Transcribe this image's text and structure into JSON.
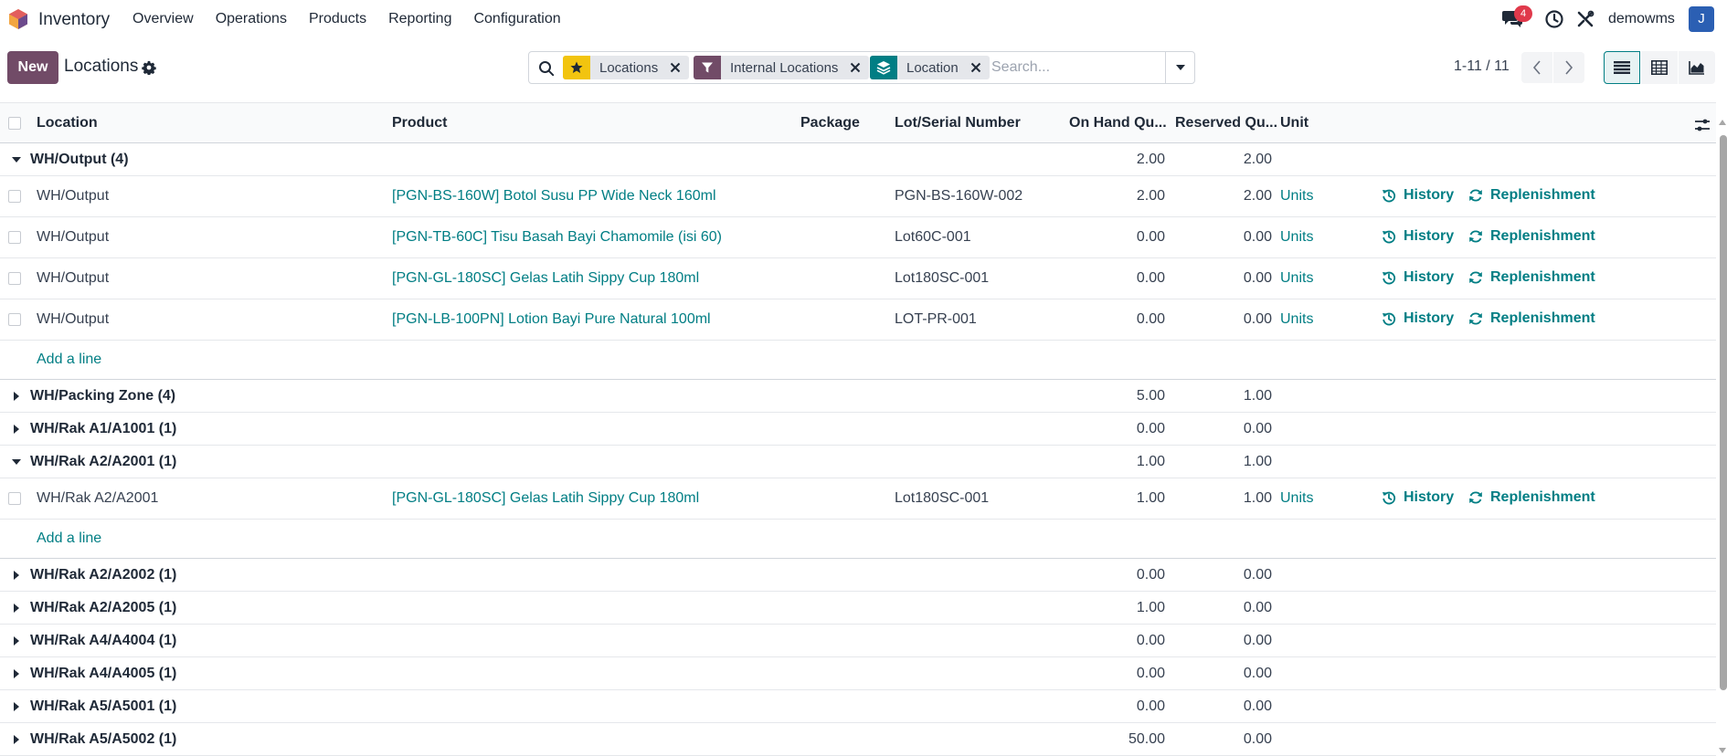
{
  "navbar": {
    "app_name": "Inventory",
    "menu": [
      "Overview",
      "Operations",
      "Products",
      "Reporting",
      "Configuration"
    ],
    "chat_badge": "4",
    "user_name": "demowms",
    "avatar_letter": "J"
  },
  "control_panel": {
    "new_label": "New",
    "title": "Locations",
    "facets": [
      {
        "label": "Locations",
        "icon": "star-icon"
      },
      {
        "label": "Internal Locations",
        "icon": "filter-icon"
      },
      {
        "label": "Location",
        "icon": "layers-icon"
      }
    ],
    "search_placeholder": "Search...",
    "pager": "1-11 / 11"
  },
  "table": {
    "headers": {
      "location": "Location",
      "product": "Product",
      "package": "Package",
      "lot": "Lot/Serial Number",
      "onhand": "On Hand Qu...",
      "reserved": "Reserved Qu...",
      "unit": "Unit"
    },
    "history_label": "History",
    "replenish_label": "Replenishment",
    "add_line_label": "Add a line",
    "groups": [
      {
        "name": "WH/Output (4)",
        "expanded": true,
        "onhand": "2.00",
        "reserved": "2.00",
        "rows": [
          {
            "location": "WH/Output",
            "product": "[PGN-BS-160W] Botol Susu PP Wide Neck 160ml",
            "lot": "PGN-BS-160W-002",
            "onhand": "2.00",
            "reserved": "2.00",
            "unit": "Units"
          },
          {
            "location": "WH/Output",
            "product": "[PGN-TB-60C] Tisu Basah Bayi Chamomile (isi 60)",
            "lot": "Lot60C-001",
            "onhand": "0.00",
            "reserved": "0.00",
            "unit": "Units"
          },
          {
            "location": "WH/Output",
            "product": "[PGN-GL-180SC] Gelas Latih Sippy Cup 180ml",
            "lot": "Lot180SC-001",
            "onhand": "0.00",
            "reserved": "0.00",
            "unit": "Units"
          },
          {
            "location": "WH/Output",
            "product": "[PGN-LB-100PN] Lotion Bayi Pure Natural 100ml",
            "lot": "LOT-PR-001",
            "onhand": "0.00",
            "reserved": "0.00",
            "unit": "Units"
          }
        ]
      },
      {
        "name": "WH/Packing Zone (4)",
        "expanded": false,
        "onhand": "5.00",
        "reserved": "1.00",
        "rows": []
      },
      {
        "name": "WH/Rak A1/A1001 (1)",
        "expanded": false,
        "onhand": "0.00",
        "reserved": "0.00",
        "rows": []
      },
      {
        "name": "WH/Rak A2/A2001 (1)",
        "expanded": true,
        "onhand": "1.00",
        "reserved": "1.00",
        "rows": [
          {
            "location": "WH/Rak A2/A2001",
            "product": "[PGN-GL-180SC] Gelas Latih Sippy Cup 180ml",
            "lot": "Lot180SC-001",
            "onhand": "1.00",
            "reserved": "1.00",
            "unit": "Units"
          }
        ]
      },
      {
        "name": "WH/Rak A2/A2002 (1)",
        "expanded": false,
        "onhand": "0.00",
        "reserved": "0.00",
        "rows": []
      },
      {
        "name": "WH/Rak A2/A2005 (1)",
        "expanded": false,
        "onhand": "1.00",
        "reserved": "0.00",
        "rows": []
      },
      {
        "name": "WH/Rak A4/A4004 (1)",
        "expanded": false,
        "onhand": "0.00",
        "reserved": "0.00",
        "rows": []
      },
      {
        "name": "WH/Rak A4/A4005 (1)",
        "expanded": false,
        "onhand": "0.00",
        "reserved": "0.00",
        "rows": []
      },
      {
        "name": "WH/Rak A5/A5001 (1)",
        "expanded": false,
        "onhand": "0.00",
        "reserved": "0.00",
        "rows": []
      },
      {
        "name": "WH/Rak A5/A5002 (1)",
        "expanded": false,
        "onhand": "50.00",
        "reserved": "0.00",
        "rows": []
      }
    ]
  },
  "colors": {
    "brand": "#714b67",
    "accent": "#017e84",
    "badge": "#e0394b",
    "facet_star": "#f2c40f",
    "facet_filter": "#714b67",
    "facet_group": "#017e84"
  }
}
